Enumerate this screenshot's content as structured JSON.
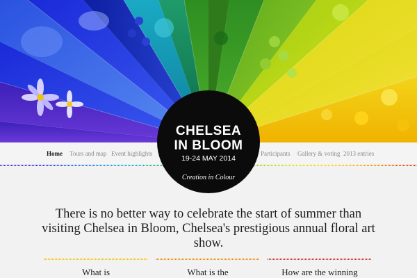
{
  "badge": {
    "title_line1": "CHELSEA",
    "title_line2": "IN BLOOM",
    "dates": "19-24 MAY 2014",
    "motto": "Creation in Colour"
  },
  "nav": {
    "items": [
      {
        "label": "Home",
        "active": true
      },
      {
        "label": "Tours and map",
        "active": false
      },
      {
        "label": "Event highlights",
        "active": false
      },
      {
        "label": "Participants",
        "active": false
      },
      {
        "label": "Gallery & voting",
        "active": false
      },
      {
        "label": "2013 entries",
        "active": false
      }
    ]
  },
  "intro": {
    "text": "There is no better way to celebrate the start of summer than visiting Chelsea in Bloom, Chelsea's prestigious annual floral art show."
  },
  "columns": [
    {
      "heading": "What is",
      "color": "#f2c200"
    },
    {
      "heading": "What is the",
      "color": "#ee8a00"
    },
    {
      "heading": "How are the winning",
      "color": "#d12b1a"
    }
  ],
  "colors": {
    "background": "#f2f2f2",
    "badge": "#0b0b0b",
    "spectrum": [
      "#5a2bd0",
      "#2a2fe0",
      "#1f6fe6",
      "#19a8c9",
      "#2bb36a",
      "#39a51a",
      "#8cc81a",
      "#d8de10",
      "#f4cc12"
    ]
  }
}
